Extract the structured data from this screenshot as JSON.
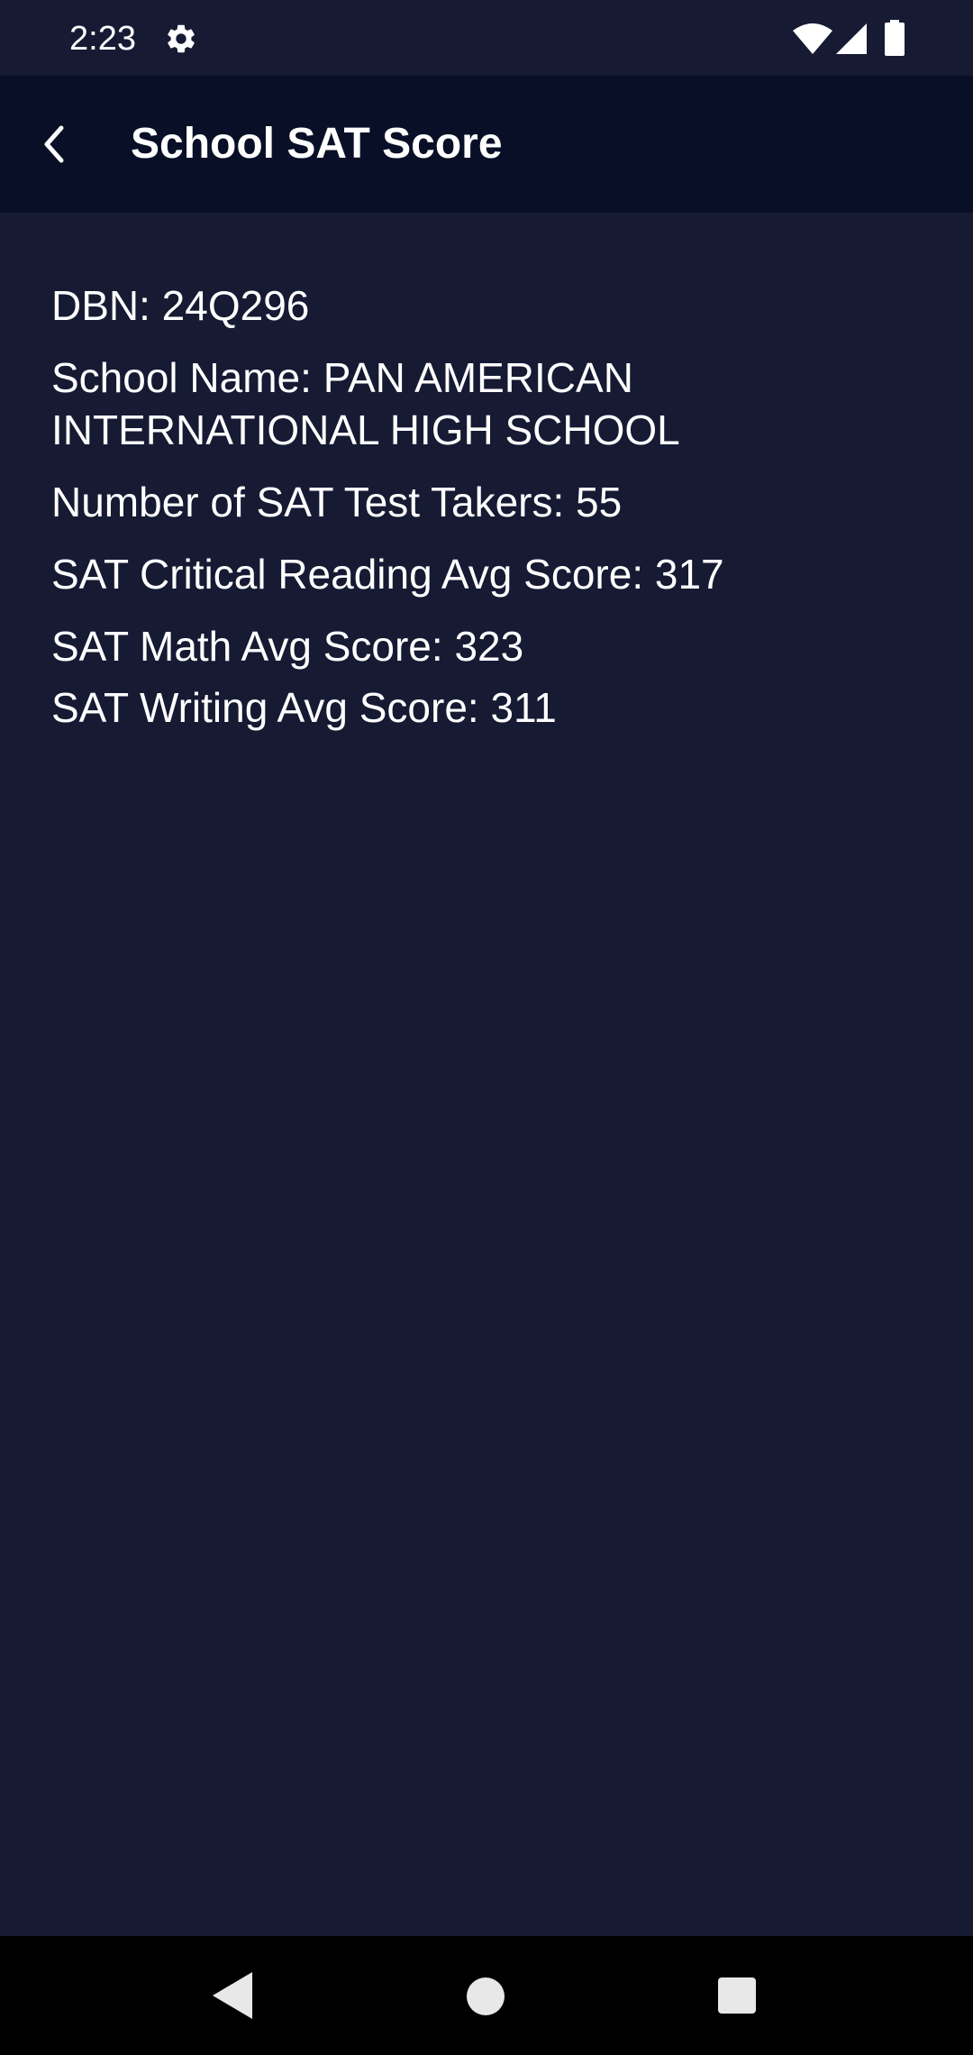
{
  "status_bar": {
    "time": "2:23",
    "icons": [
      "settings-icon",
      "wifi-icon",
      "signal-icon",
      "battery-icon"
    ]
  },
  "app_bar": {
    "title": "School SAT Score",
    "back_icon": "chevron-left-icon"
  },
  "school": {
    "dbn": "DBN: 24Q296",
    "name": "School Name: PAN AMERICAN INTERNATIONAL HIGH SCHOOL",
    "test_takers": "Number of SAT Test Takers: 55",
    "reading_avg": "SAT Critical Reading Avg Score: 317",
    "math_avg": "SAT Math Avg Score: 323",
    "writing_avg": "SAT Writing Avg Score: 311"
  },
  "nav_bar": {
    "icons": [
      "nav-back-icon",
      "nav-home-icon",
      "nav-recents-icon"
    ]
  },
  "colors": {
    "background": "#161a33",
    "app_bar": "#080f27",
    "text": "#ffffff",
    "nav_bar": "#000000"
  }
}
